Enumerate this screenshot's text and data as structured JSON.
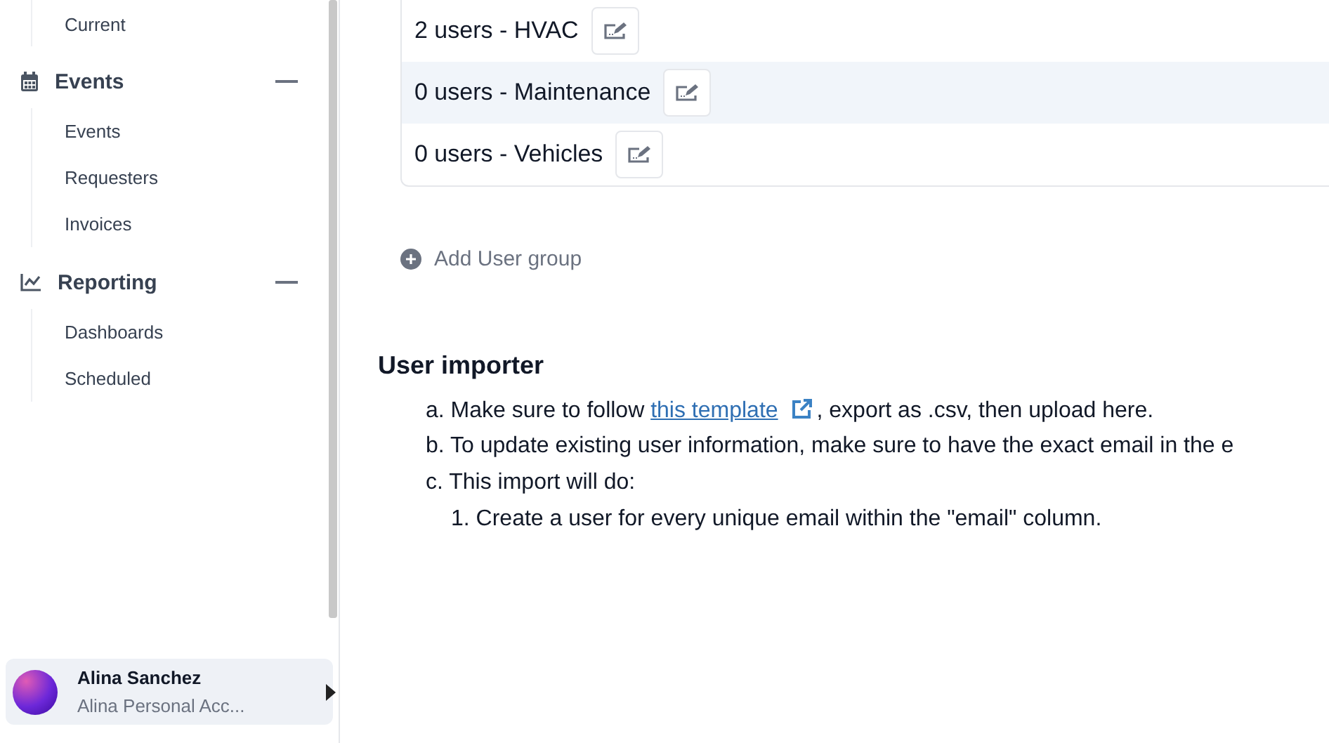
{
  "sidebar": {
    "top_item": "Current",
    "sections": [
      {
        "kind": "calendar",
        "label": "Events",
        "expanded": true,
        "items": [
          "Events",
          "Requesters",
          "Invoices"
        ]
      },
      {
        "kind": "chart",
        "label": "Reporting",
        "expanded": true,
        "items": [
          "Dashboards",
          "Scheduled"
        ]
      }
    ],
    "account": {
      "name": "Alina Sanchez",
      "subtitle": "Alina Personal Acc..."
    }
  },
  "user_groups": [
    {
      "label": "2 users - HVAC",
      "highlighted": false
    },
    {
      "label": "0 users - Maintenance",
      "highlighted": true
    },
    {
      "label": "0 users - Vehicles",
      "highlighted": false
    }
  ],
  "add_group": "Add User group",
  "importer": {
    "title": "User importer",
    "steps": [
      {
        "marker": "a.",
        "before": "Make sure to follow ",
        "link": "this template",
        "after": ", export as .csv, then upload here."
      },
      {
        "marker": "b.",
        "text": "To update existing user information, make sure to have the exact email in the e"
      },
      {
        "marker": "c.",
        "text": "This import will do:"
      }
    ],
    "substeps": [
      {
        "marker": "1.",
        "text": "Create a user for every unique email within the \"email\" column."
      }
    ]
  }
}
